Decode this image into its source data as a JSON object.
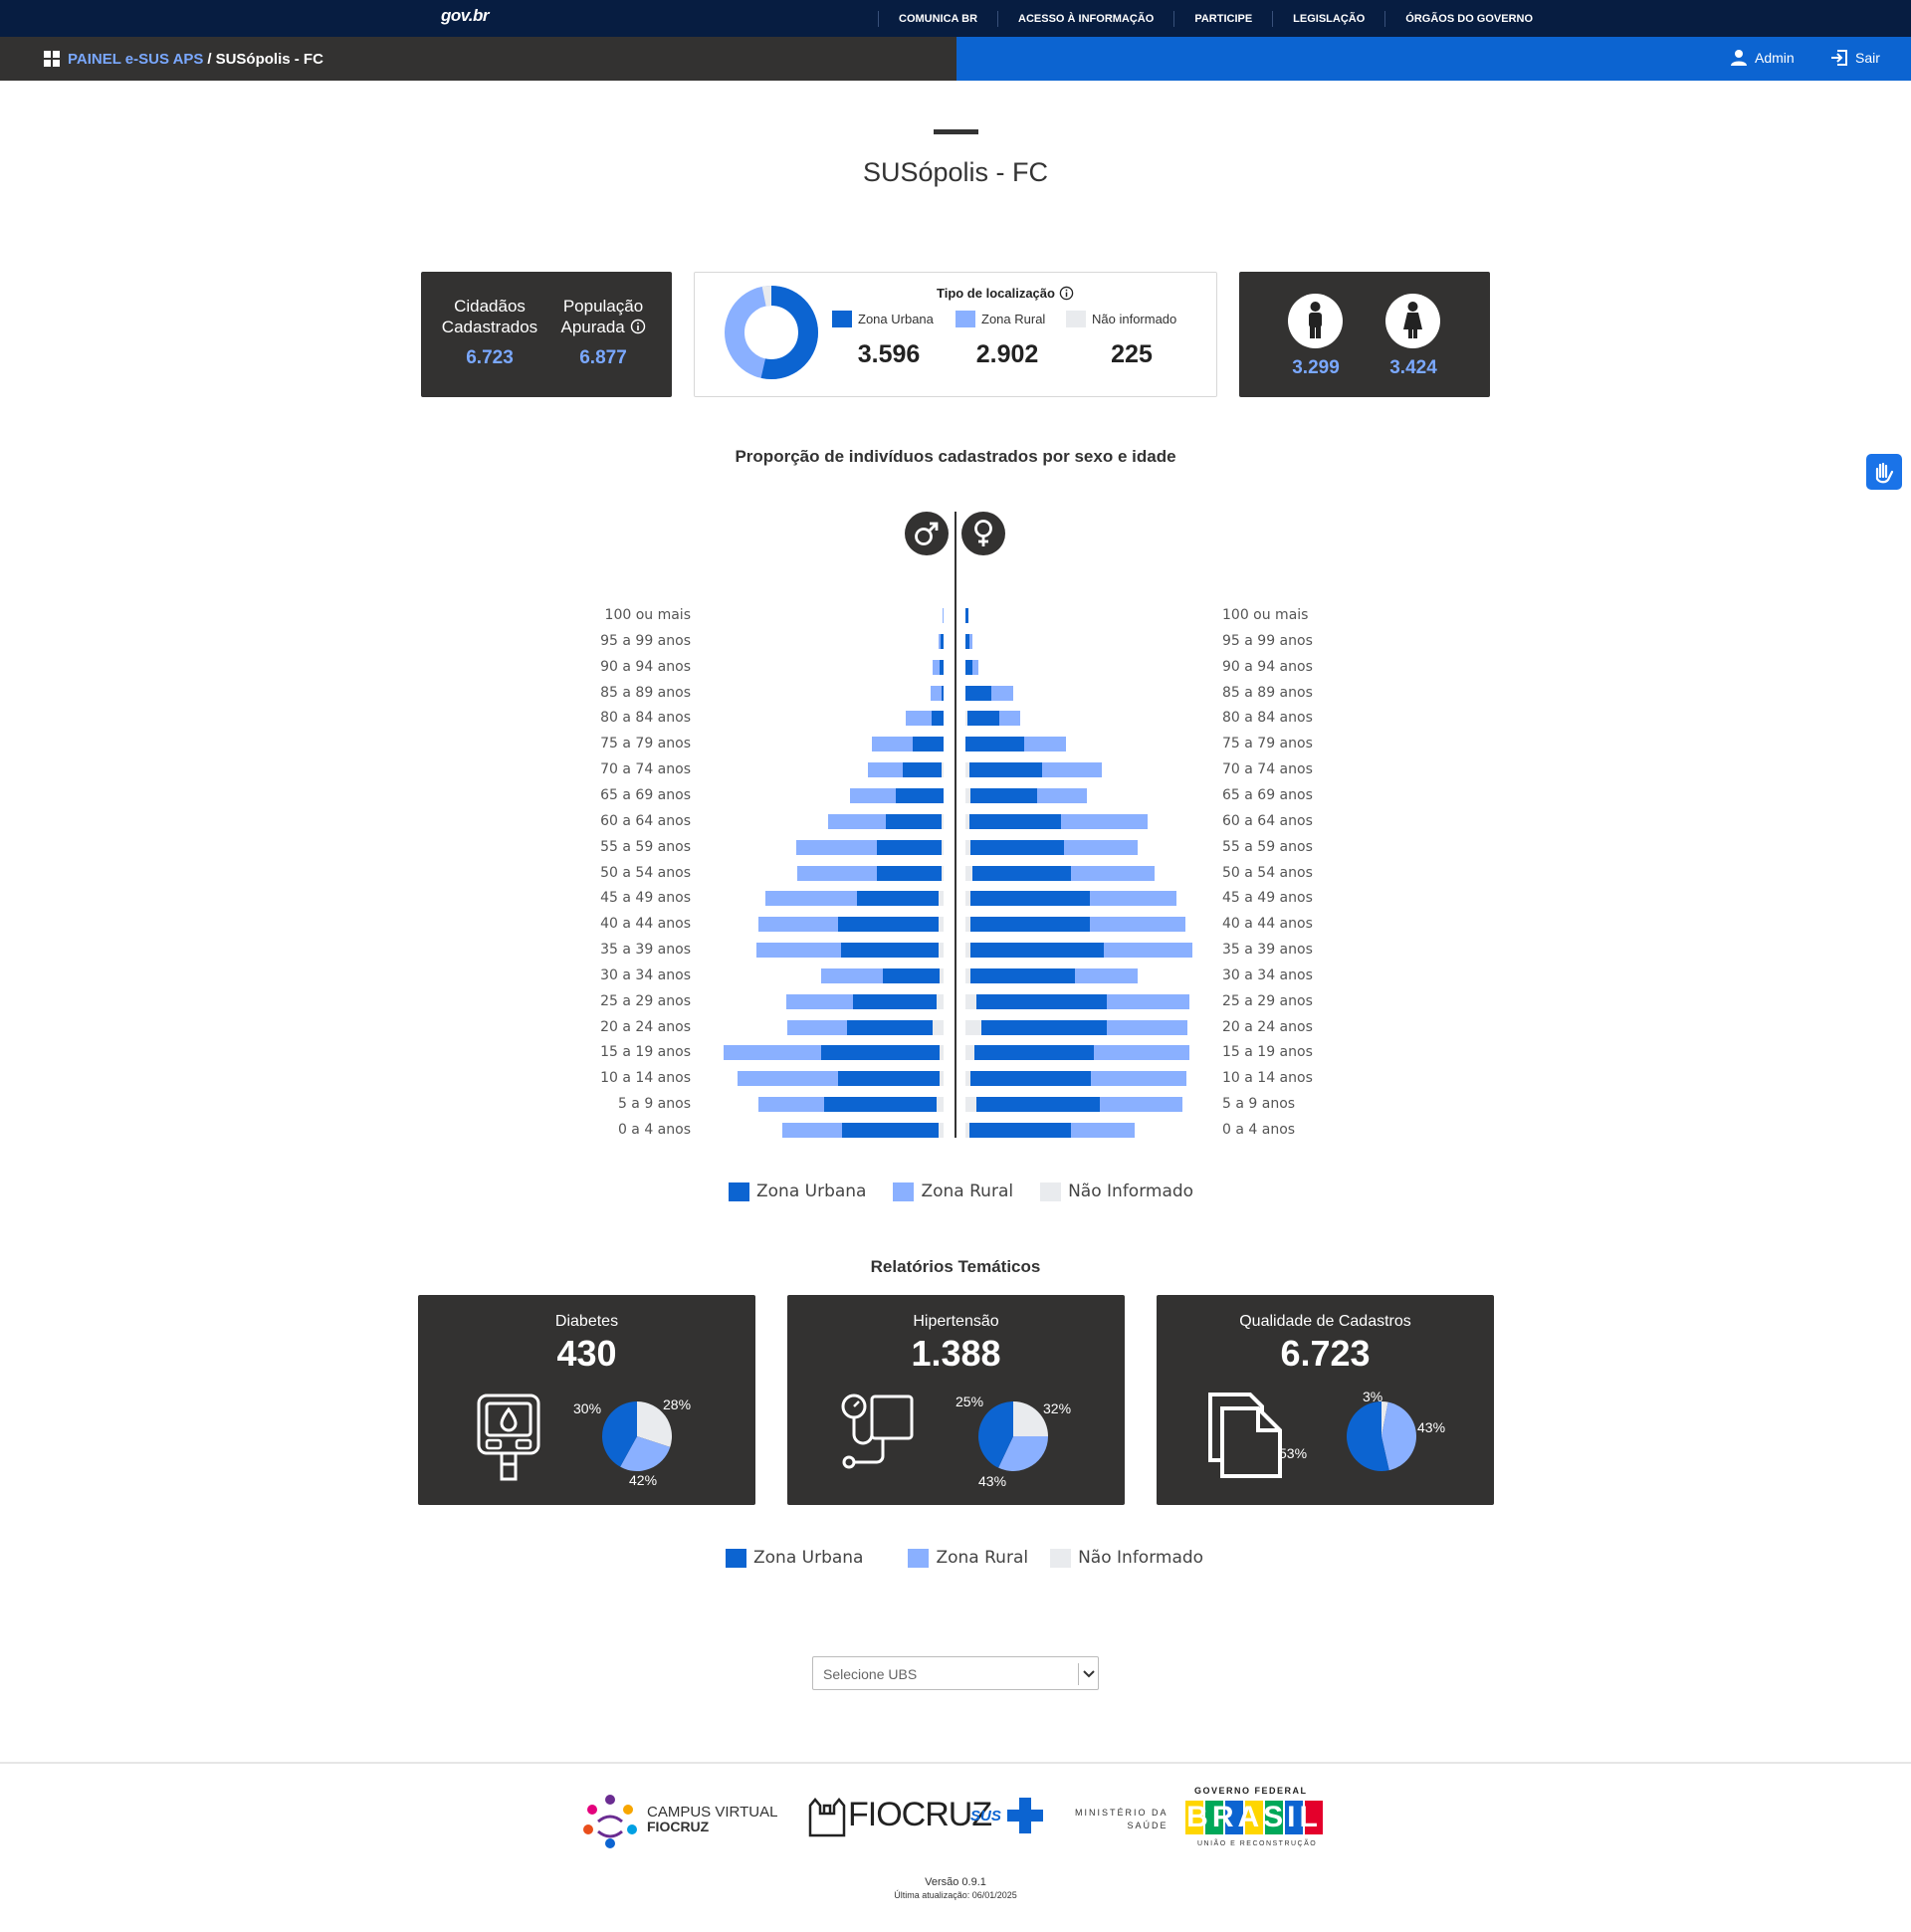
{
  "govbar": {
    "logo": "gov.br",
    "links": [
      "COMUNICA BR",
      "ACESSO À INFORMAÇÃO",
      "PARTICIPE",
      "LEGISLAÇÃO",
      "ÓRGÃOS DO GOVERNO"
    ]
  },
  "appbar": {
    "breadcrumb_root": "PAINEL e-SUS APS",
    "breadcrumb_sep": "/",
    "breadcrumb_current": "SUSópolis - FC",
    "user_label": "Admin",
    "logout_label": "Sair"
  },
  "page_title": "SUSópolis - FC",
  "summary": {
    "cidadaos_label_1": "Cidadãos",
    "cidadaos_label_2": "Cadastrados",
    "cidadaos_value": "6.723",
    "populacao_label_1": "População",
    "populacao_label_2": "Apurada",
    "populacao_value": "6.877",
    "localizacao_title": "Tipo de localização",
    "urbana_label": "Zona Urbana",
    "rural_label": "Zona Rural",
    "nao_informado_label": "Não informado",
    "urbana_value": "3.596",
    "rural_value": "2.902",
    "nao_informado_value": "225",
    "male_value": "3.299",
    "female_value": "3.424"
  },
  "colors": {
    "urbana": "#0c64d1",
    "rural": "#8ab0ff",
    "nao_informado": "#e9ebee",
    "dark_card": "#333231",
    "accent_text": "#7aa8ff"
  },
  "pyramid": {
    "title": "Proporção de indivíduos cadastrados por sexo e idade",
    "male_symbol": "♂",
    "female_symbol": "♀",
    "legend": [
      "Zona Urbana",
      "Zona Rural",
      "Não Informado"
    ]
  },
  "chart_data": {
    "type": "bar",
    "categories": [
      "100 ou mais",
      "95 a 99 anos",
      "90 a 94 anos",
      "85 a 89 anos",
      "80 a 84 anos",
      "75 a 79 anos",
      "70 a 74 anos",
      "65 a 69 anos",
      "60 a 64 anos",
      "55 a 59 anos",
      "50 a 54 anos",
      "45 a 49 anos",
      "40 a 44 anos",
      "35 a 39 anos",
      "30 a 34 anos",
      "25 a 29 anos",
      "20 a 24 anos",
      "15 a 19 anos",
      "10 a 14 anos",
      "5 a 9 anos",
      "0 a 4 anos"
    ],
    "male": {
      "urbana": [
        0,
        3,
        4,
        2,
        13,
        34,
        43,
        53,
        62,
        72,
        72,
        90,
        110,
        107,
        63,
        92,
        95,
        131,
        112,
        124,
        106
      ],
      "rural": [
        1,
        2,
        8,
        12,
        29,
        45,
        38,
        50,
        64,
        89,
        87,
        101,
        88,
        94,
        68,
        74,
        65,
        108,
        111,
        72,
        66
      ],
      "nao_informado": [
        0,
        0,
        0,
        0,
        0,
        0,
        2,
        0,
        2,
        2,
        2,
        6,
        6,
        6,
        4,
        8,
        12,
        4,
        4,
        8,
        6
      ]
    },
    "female": {
      "urbana": [
        3,
        4,
        8,
        29,
        35,
        65,
        81,
        73,
        102,
        103,
        109,
        131,
        131,
        147,
        115,
        144,
        138,
        132,
        132,
        136,
        113
      ],
      "rural": [
        0,
        4,
        6,
        24,
        24,
        46,
        66,
        55,
        95,
        81,
        92,
        96,
        106,
        98,
        69,
        91,
        89,
        105,
        106,
        92,
        70
      ],
      "nao_informado": [
        0,
        0,
        0,
        0,
        2,
        0,
        4,
        6,
        4,
        6,
        8,
        6,
        6,
        6,
        6,
        12,
        18,
        10,
        6,
        12,
        4
      ]
    },
    "xlabel": "",
    "ylabel": ""
  },
  "thematic": {
    "title": "Relatórios Temáticos",
    "cards": [
      {
        "name": "Diabetes",
        "value": "430",
        "pct_nao_informado": "30%",
        "pct_rural": "28%",
        "pct_urbana": "42%"
      },
      {
        "name": "Hipertensão",
        "value": "1.388",
        "pct_nao_informado": "25%",
        "pct_rural": "32%",
        "pct_urbana": "43%"
      },
      {
        "name": "Qualidade de Cadastros",
        "value": "6.723",
        "pct_nao_informado": "3%",
        "pct_rural": "43%",
        "pct_urbana": "53%"
      }
    ],
    "legend": [
      "Zona Urbana",
      "Zona Rural",
      "Não Informado"
    ]
  },
  "ubs_select": {
    "placeholder": "Selecione UBS"
  },
  "footer": {
    "campus_line1": "CAMPUS VIRTUAL",
    "campus_line2": "FIOCRUZ",
    "fiocruz": "FIOCRUZ",
    "sus": "SUS",
    "ministerio_line1": "MINISTÉRIO DA",
    "ministerio_line2": "SAÚDE",
    "gov_federal": "GOVERNO FEDERAL",
    "brasil": "BRASIL",
    "brasil_tagline": "UNIÃO E RECONSTRUÇÃO",
    "version": "Versão 0.9.1",
    "updated": "Última atualização: 06/01/2025"
  }
}
